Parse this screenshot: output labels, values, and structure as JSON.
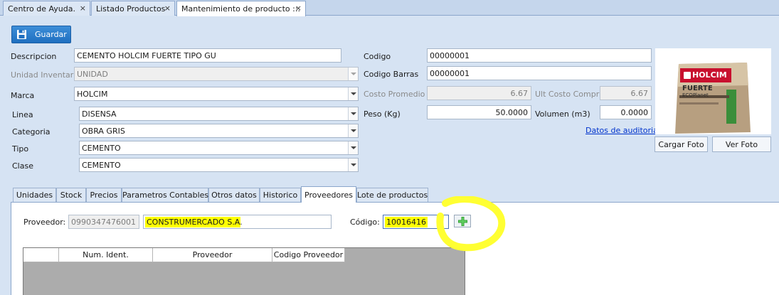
{
  "doc_tabs": [
    {
      "label": "Centro de Ayuda.",
      "close": "×"
    },
    {
      "label": "Listado Productos",
      "close": "×"
    },
    {
      "label": "Mantenimiento de producto ::.",
      "close": "×"
    }
  ],
  "toolbar": {
    "save_label": "Guardar"
  },
  "form": {
    "descripcion": {
      "label": "Descripcion",
      "value": "CEMENTO HOLCIM FUERTE TIPO GU"
    },
    "unidad_inventario": {
      "label": "Unidad Inventario",
      "value": "UNIDAD"
    },
    "marca": {
      "label": "Marca",
      "value": "HOLCIM"
    },
    "linea": {
      "label": "Linea",
      "value": "DISENSA"
    },
    "categoria": {
      "label": "Categoria",
      "value": "OBRA GRIS"
    },
    "tipo": {
      "label": "Tipo",
      "value": "CEMENTO"
    },
    "clase": {
      "label": "Clase",
      "value": "CEMENTO"
    },
    "codigo": {
      "label": "Codigo",
      "value": "00000001"
    },
    "codigo_barras": {
      "label": "Codigo Barras",
      "value": "00000001"
    },
    "costo_promedio": {
      "label": "Costo Promedio",
      "value": "6.67"
    },
    "ult_costo_compra": {
      "label": "Ult Costo Compra",
      "value": "6.67"
    },
    "peso": {
      "label": "Peso (Kg)",
      "value": "50.0000"
    },
    "volumen": {
      "label": "Volumen (m3)",
      "value": "0.0000"
    },
    "auditoria_link": "Datos de auditoria"
  },
  "photo": {
    "brand": "HOLCIM",
    "line1": "FUERTE",
    "line2": "ECOPlanet",
    "cargar_label": "Cargar Foto",
    "ver_label": "Ver Foto"
  },
  "section_tabs": [
    "Unidades",
    "Stock",
    "Precios",
    "Parametros Contables",
    "Otros datos",
    "Historico",
    "Proveedores",
    "Lote de productos"
  ],
  "proveedores": {
    "proveedor_label": "Proveedor:",
    "proveedor_id": "0990347476001",
    "proveedor_name": "CONSTRUMERCADO S.A.",
    "codigo_label": "Código:",
    "codigo_value": "10016416",
    "grid_headers": [
      "",
      "Num. Ident.",
      "Proveedor",
      "Codigo Proveedor"
    ]
  },
  "colors": {
    "accent": "#2a7bcf",
    "highlight": "#ffff00",
    "marker": "#ffff33"
  }
}
